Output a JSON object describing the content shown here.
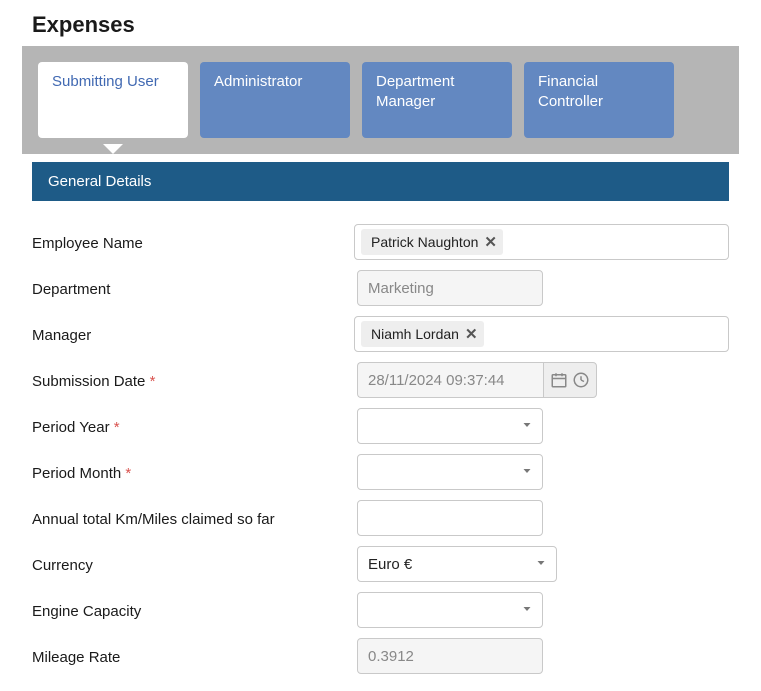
{
  "page_title": "Expenses",
  "tabs": [
    {
      "label": "Submitting User"
    },
    {
      "label": "Administrator"
    },
    {
      "label": "Department Manager"
    },
    {
      "label": "Financial Controller"
    }
  ],
  "section_header": "General Details",
  "labels": {
    "employee_name": "Employee Name",
    "department": "Department",
    "manager": "Manager",
    "submission_date": "Submission Date",
    "period_year": "Period Year",
    "period_month": "Period Month",
    "annual_km": "Annual total Km/Miles claimed so far",
    "currency": "Currency",
    "engine_capacity": "Engine Capacity",
    "mileage_rate": "Mileage Rate"
  },
  "values": {
    "employee_name": "Patrick Naughton",
    "department": "Marketing",
    "manager": "Niamh Lordan",
    "submission_date": "28/11/2024 09:37:44",
    "period_year": "",
    "period_month": "",
    "annual_km": "",
    "currency": "Euro €",
    "engine_capacity": "",
    "mileage_rate": "0.3912"
  },
  "required_marker": "*"
}
